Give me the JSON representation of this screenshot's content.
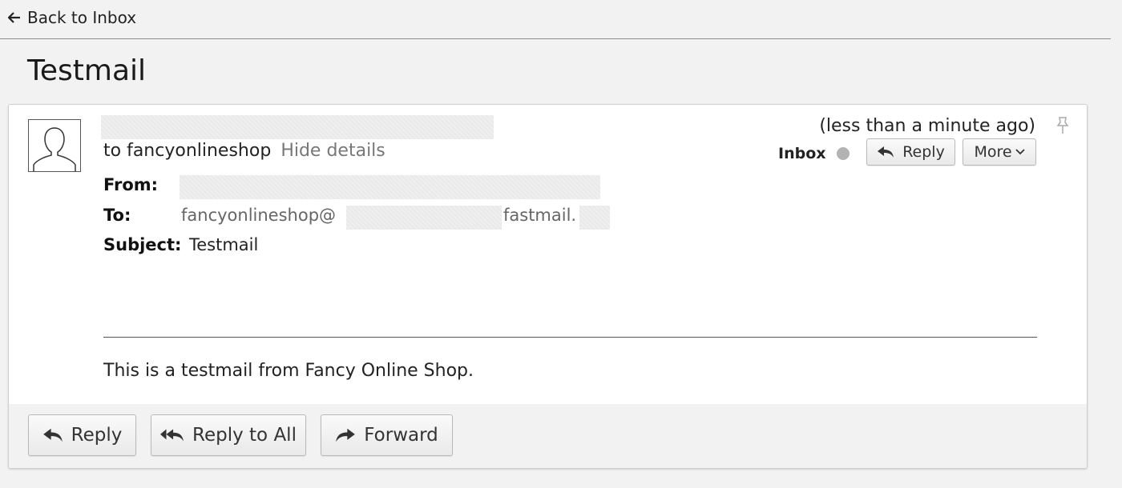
{
  "nav": {
    "back_label": "Back to Inbox"
  },
  "message": {
    "title": "Testmail",
    "to_summary": "to fancyonlineshop",
    "hide_details_label": "Hide details",
    "timestamp": "(less than a minute ago)",
    "mailbox_label": "Inbox",
    "reply_label": "Reply",
    "more_label": "More",
    "headers": {
      "from_label": "From:",
      "to_label": "To:",
      "to_value_prefix": "fancyonlineshop@",
      "to_value_suffix": "fastmail.",
      "subject_label": "Subject:",
      "subject_value": "Testmail"
    },
    "body": "This is a testmail from Fancy Online Shop."
  },
  "actions": {
    "reply_label": "Reply",
    "reply_all_label": "Reply to All",
    "forward_label": "Forward"
  },
  "icons": {
    "back": "left-arrow-icon",
    "avatar": "user-silhouette-icon",
    "pin": "pin-icon",
    "reply": "reply-arrow-icon",
    "reply_all": "reply-all-icon",
    "forward": "forward-arrow-icon",
    "chevron": "chevron-down-icon"
  },
  "colors": {
    "background": "#f2f2f2",
    "card": "#ffffff",
    "status_dot": "#b3b3b3",
    "muted_text": "#777777"
  }
}
